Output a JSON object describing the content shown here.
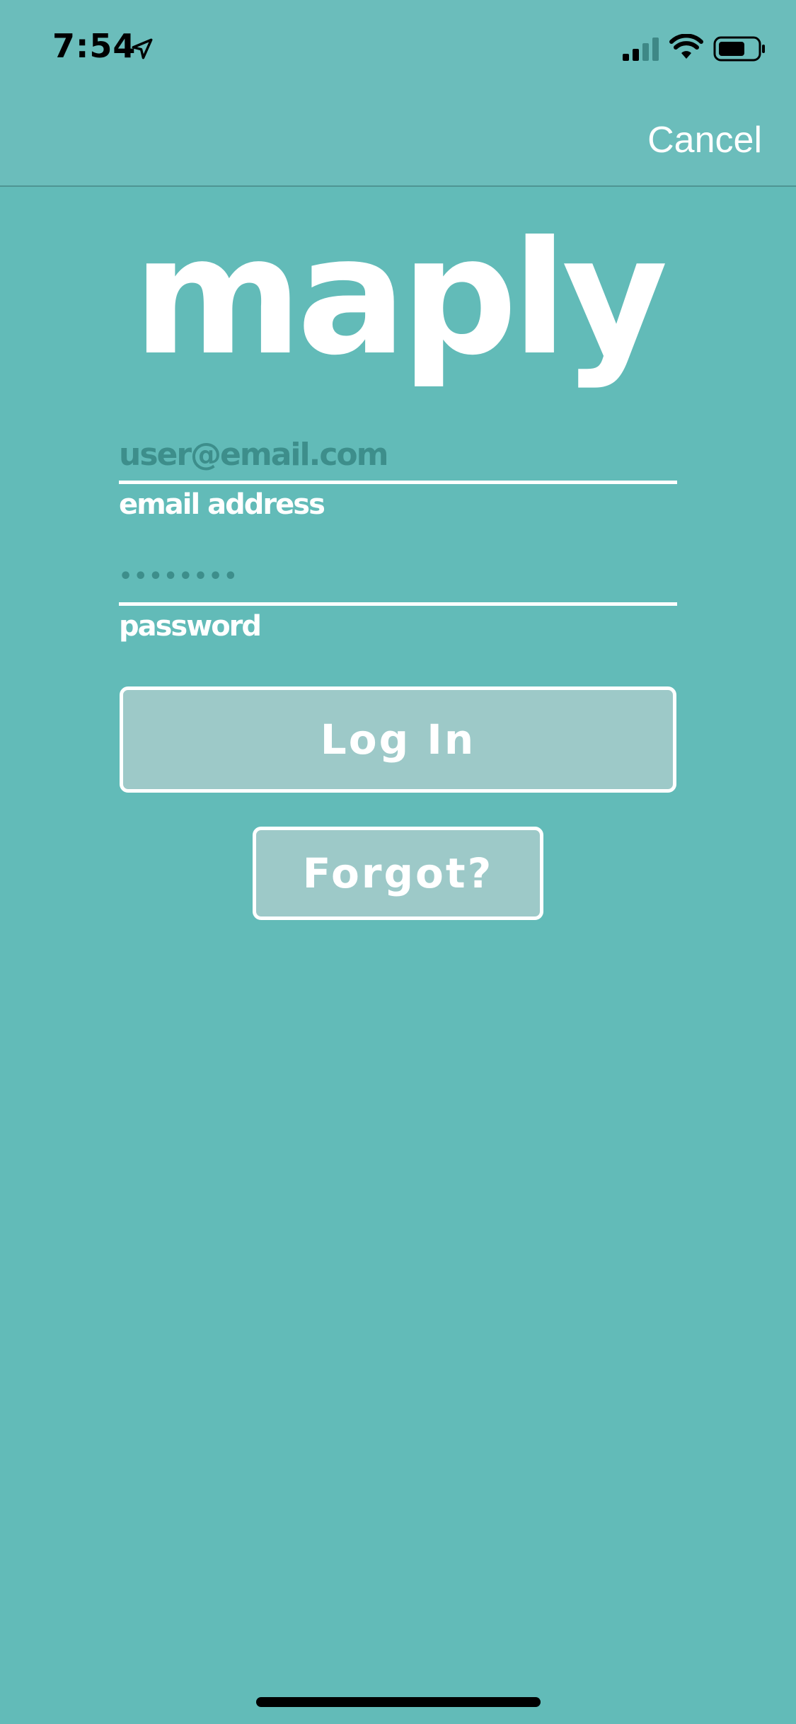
{
  "status_bar": {
    "time": "7:54",
    "icons": [
      "location-arrow-icon",
      "cellular-signal-icon",
      "wifi-icon",
      "battery-icon"
    ]
  },
  "nav": {
    "cancel_label": "Cancel"
  },
  "logo": {
    "text": "maply"
  },
  "form": {
    "email": {
      "placeholder": "user@email.com",
      "value": "",
      "caption": "email address"
    },
    "password": {
      "placeholder": "••••••••",
      "value": "",
      "caption": "password"
    },
    "login_label": "Log In",
    "forgot_label": "Forgot?"
  },
  "colors": {
    "background": "#62BBB8",
    "nav_background": "#6BBDBB",
    "button_fill": "#9DC9C8",
    "placeholder": "#3D8E8B",
    "foreground": "#FFFFFF"
  }
}
